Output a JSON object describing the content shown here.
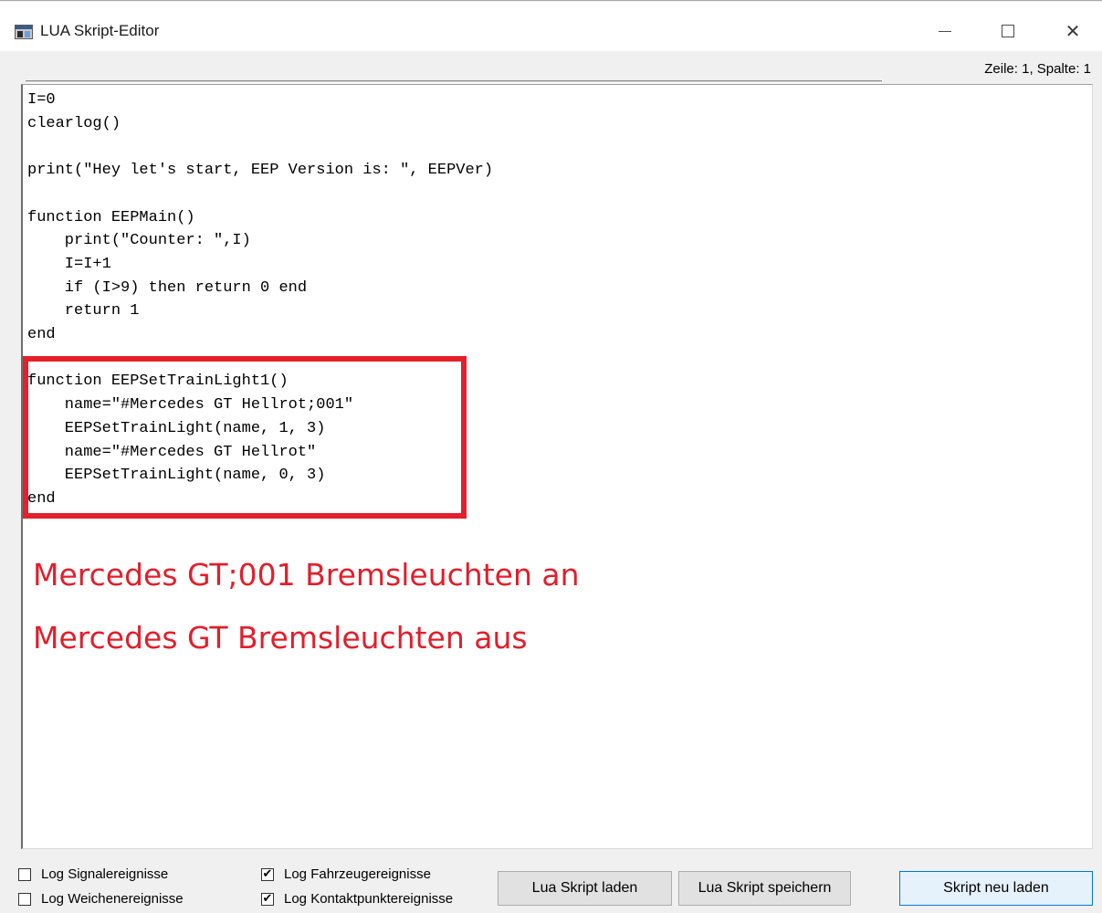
{
  "window": {
    "title": "LUA Skript-Editor",
    "min_symbol": "",
    "max_symbol": "",
    "close_symbol": "✕"
  },
  "status": {
    "cursor": "Zeile: 1, Spalte: 1"
  },
  "editor": {
    "code_lines": [
      "I=0",
      "clearlog()",
      "",
      "print(\"Hey let's start, EEP Version is: \", EEPVer)",
      "",
      "function EEPMain()",
      "    print(\"Counter: \",I)",
      "    I=I+1",
      "    if (I>9) then return 0 end",
      "    return 1",
      "end",
      "",
      "function EEPSetTrainLight1()",
      "    name=\"#Mercedes GT Hellrot;001\"",
      "    EEPSetTrainLight(name, 1, 3)",
      "    name=\"#Mercedes GT Hellrot\"",
      "    EEPSetTrainLight(name, 0, 3)",
      "end"
    ],
    "annotations": {
      "note1": "Mercedes GT;001 Bremsleuchten an",
      "note2": "Mercedes GT Bremsleuchten aus",
      "color": "#e31e2b"
    }
  },
  "checkboxes": [
    {
      "label": "Log Signalereignisse",
      "checked": false
    },
    {
      "label": "Log Weichenereignisse",
      "checked": false
    },
    {
      "label": "Log Fahrzeugereignisse",
      "checked": true
    },
    {
      "label": "Log Kontaktpunktereignisse",
      "checked": true
    }
  ],
  "buttons": {
    "load": "Lua Skript laden",
    "save": "Lua Skript speichern",
    "reload": "Skript neu laden"
  },
  "check_mark": "✔"
}
